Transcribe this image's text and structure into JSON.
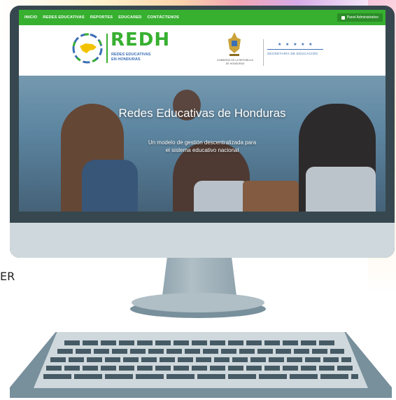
{
  "nav": {
    "items": [
      "INICIO",
      "REDES EDUCATIVAS",
      "REPORTES",
      "EDUCARED",
      "CONTÁCTENOS"
    ],
    "admin_label": "Panel Administrativo"
  },
  "logo": {
    "title": "REDH",
    "subtitle_line1": "REDES EDUCATIVAS",
    "subtitle_line2": "EN HONDURAS"
  },
  "gov": {
    "emblem_text": "GOBIERNO DE LA REPÚBLICA DE HONDURAS",
    "secretaria": "SECRETARÍA DE EDUCACIÓN",
    "stars": "★ ★ ★ ★ ★"
  },
  "hero": {
    "title": "Redes Educativas de Honduras",
    "subtitle_line1": "Un modelo de gestión descentralizada para",
    "subtitle_line2": "el sistema educativo nacional"
  },
  "side_label": "ER",
  "colors": {
    "brand_green": "#37b030",
    "brand_blue": "#3b6fb6",
    "monitor_frame": "#37474f"
  }
}
